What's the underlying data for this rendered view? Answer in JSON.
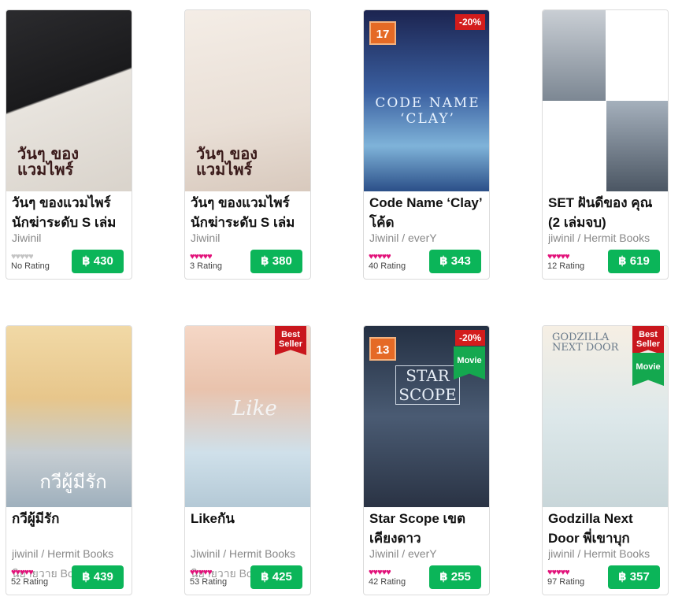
{
  "currency": "฿",
  "books": [
    {
      "title": "วันๆ ของแวมไพร์ นักฆ่าระดับ S เล่ม",
      "author": "Jiwinil",
      "category": "",
      "hearts": 0,
      "rating_label": "No Rating",
      "price": "฿ 430",
      "badge_discount": "",
      "badge_top": "",
      "badge_movie": "",
      "stamp": "",
      "cover_text": "วันๆ ของ แวมไพร์"
    },
    {
      "title": "วันๆ ของแวมไพร์ นักฆ่าระดับ S เล่ม",
      "author": "Jiwinil",
      "category": "",
      "hearts": 5,
      "rating_label": "3 Rating",
      "price": "฿ 380",
      "badge_discount": "",
      "badge_top": "",
      "badge_movie": "",
      "stamp": "",
      "cover_text": "วันๆ ของ แวมไพร์"
    },
    {
      "title": "Code Name ‘Clay’ โค้ด",
      "author": "Jiwinil / everY",
      "category": "",
      "hearts": 5,
      "rating_label": "40 Rating",
      "price": "฿ 343",
      "badge_discount": "-20%",
      "badge_top": "",
      "badge_movie": "",
      "stamp": "17",
      "cover_text": "CODE NAME ‘CLAY’"
    },
    {
      "title": "SET ฝันดีของ คุณ (2 เล่มจบ)",
      "author": "jiwinil / Hermit Books",
      "category": "",
      "hearts": 5,
      "rating_label": "12 Rating",
      "price": "฿ 619",
      "badge_discount": "",
      "badge_top": "",
      "badge_movie": "",
      "stamp": "",
      "cover_text": ""
    },
    {
      "title": "กวีผู้มีรัก",
      "author": "jiwinil / Hermit Books",
      "category": "นิยายวาย Boy Love /",
      "hearts": 5,
      "rating_label": "52 Rating",
      "price": "฿ 439",
      "badge_discount": "",
      "badge_top": "",
      "badge_movie": "",
      "stamp": "",
      "cover_text": "กวีผู้มีรัก"
    },
    {
      "title": "Likeกัน",
      "author": "Jiwinil / Hermit Books",
      "category": "นิยายวาย Boy Love /",
      "hearts": 5,
      "rating_label": "53 Rating",
      "price": "฿ 425",
      "badge_discount": "",
      "badge_top": "Best Seller",
      "badge_movie": "",
      "stamp": "",
      "cover_text": "Like"
    },
    {
      "title": "Star Scope เขต เคียงดาว",
      "author": "Jiwinil / everY",
      "category": "",
      "hearts": 5,
      "rating_label": "42 Rating",
      "price": "฿ 255",
      "badge_discount": "-20%",
      "badge_top": "",
      "badge_movie": "Movie",
      "stamp": "13",
      "cover_text": "STAR SCOPE"
    },
    {
      "title": "Godzilla Next Door พี่เขาบุก",
      "author": "jiwinil / Hermit Books",
      "category": "",
      "hearts": 5,
      "rating_label": "97 Rating",
      "price": "฿ 357",
      "badge_discount": "",
      "badge_top": "Best Seller",
      "badge_movie": "Movie",
      "stamp": "",
      "cover_text": "GODZILLA NEXT DOOR"
    }
  ],
  "colors": {
    "accent": "#0bb559",
    "heart": "#e2127a",
    "badge_red": "#c9161d",
    "badge_green": "#14a84f",
    "discount": "#d31c1c"
  }
}
